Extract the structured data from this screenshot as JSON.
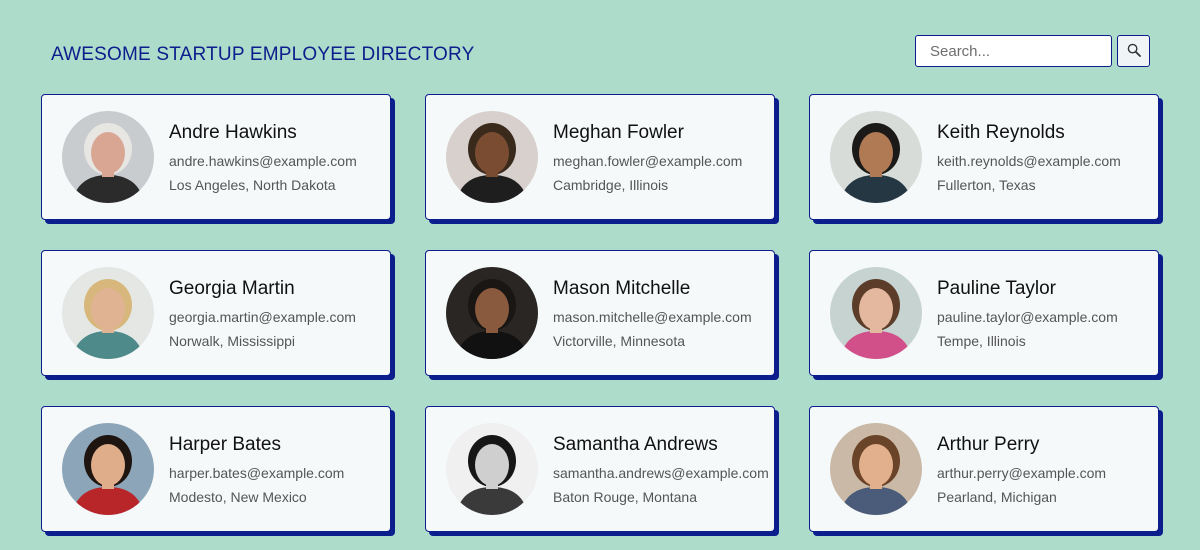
{
  "header": {
    "title": "AWESOME STARTUP EMPLOYEE DIRECTORY",
    "search_placeholder": "Search...",
    "search_icon": "magnifying-glass"
  },
  "employees": [
    {
      "name": "Andre Hawkins",
      "email": "andre.hawkins@example.com",
      "location": "Los Angeles, North Dakota",
      "bg": "#c9cccf",
      "skin": "#d9a694",
      "hair": "#e8e6e2",
      "shirt": "#2b2b2b"
    },
    {
      "name": "Meghan Fowler",
      "email": "meghan.fowler@example.com",
      "location": "Cambridge, Illinois",
      "bg": "#d8d0cc",
      "skin": "#7a4c32",
      "hair": "#3a2a1c",
      "shirt": "#1e1e1e"
    },
    {
      "name": "Keith Reynolds",
      "email": "keith.reynolds@example.com",
      "location": "Fullerton, Texas",
      "bg": "#d7dcd8",
      "skin": "#b07a55",
      "hair": "#1c1a18",
      "shirt": "#263744"
    },
    {
      "name": "Georgia Martin",
      "email": "georgia.martin@example.com",
      "location": "Norwalk, Mississippi",
      "bg": "#e4e7e4",
      "skin": "#e0b393",
      "hair": "#d8b77c",
      "shirt": "#4e8a8a"
    },
    {
      "name": "Mason Mitchelle",
      "email": "mason.mitchelle@example.com",
      "location": "Victorville, Minnesota",
      "bg": "#2a2624",
      "skin": "#8a5a3f",
      "hair": "#1a1614",
      "shirt": "#111111"
    },
    {
      "name": "Pauline Taylor",
      "email": "pauline.taylor@example.com",
      "location": "Tempe, Illinois",
      "bg": "#c6d3d0",
      "skin": "#e3b89e",
      "hair": "#5b3d2a",
      "shirt": "#d1508a"
    },
    {
      "name": "Harper Bates",
      "email": "harper.bates@example.com",
      "location": "Modesto, New Mexico",
      "bg": "#8da5b8",
      "skin": "#e0ad8a",
      "hair": "#1e1410",
      "shirt": "#b8262a"
    },
    {
      "name": "Samantha Andrews",
      "email": "samantha.andrews@example.com",
      "location": "Baton Rouge, Montana",
      "bg": "#f0f0f0",
      "skin": "#cfcfcf",
      "hair": "#161616",
      "shirt": "#3a3a3a"
    },
    {
      "name": "Arthur Perry",
      "email": "arthur.perry@example.com",
      "location": "Pearland, Michigan",
      "bg": "#c9b9a6",
      "skin": "#e2b08c",
      "hair": "#6a4428",
      "shirt": "#4b5b7a"
    }
  ]
}
